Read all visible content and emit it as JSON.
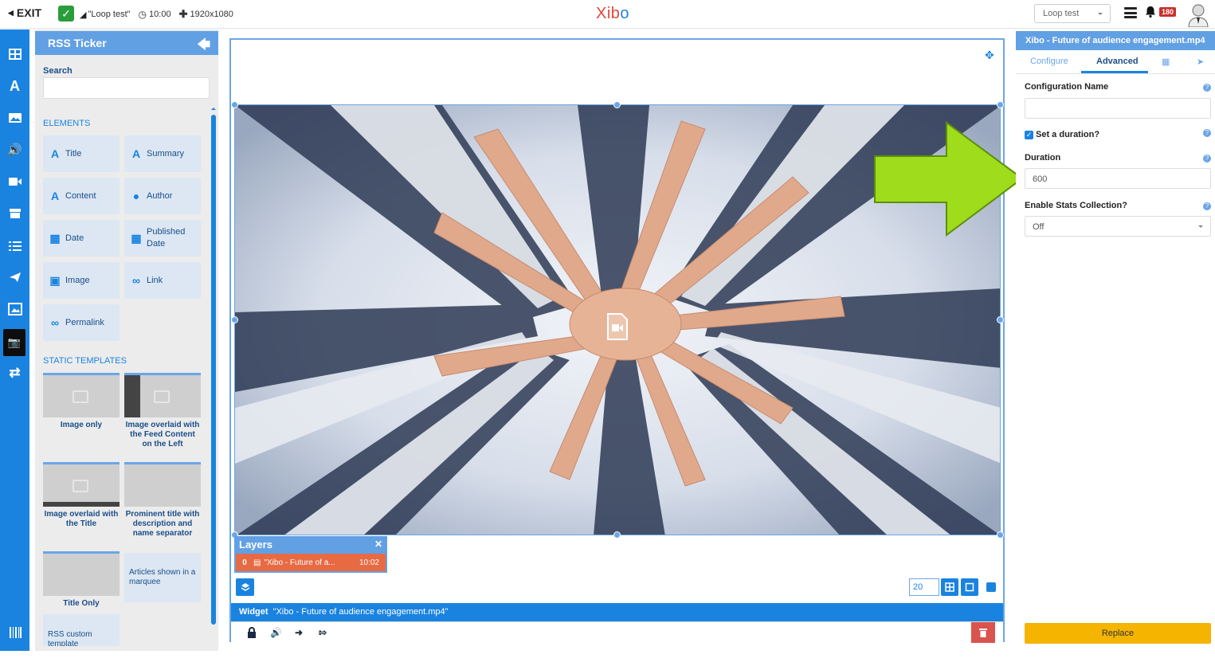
{
  "topbar": {
    "exit_label": "EXIT",
    "layout_name": "\"Loop test\"",
    "duration": "10:00",
    "resolution": "1920x1080",
    "logo_main": "Xib",
    "logo_accent": "o",
    "layout_select": "Loop test",
    "notification_count": "180"
  },
  "toolbox": {
    "title": "RSS Ticker",
    "search_label": "Search",
    "search_value": "",
    "elements_heading": "ELEMENTS",
    "elements": [
      {
        "label": "Title",
        "icon": "text-icon"
      },
      {
        "label": "Summary",
        "icon": "text-icon"
      },
      {
        "label": "Content",
        "icon": "text-icon"
      },
      {
        "label": "Author",
        "icon": "user-icon"
      },
      {
        "label": "Date",
        "icon": "calendar-icon"
      },
      {
        "label": "Published Date",
        "icon": "calendar-icon"
      },
      {
        "label": "Image",
        "icon": "image-icon"
      },
      {
        "label": "Link",
        "icon": "link-icon"
      },
      {
        "label": "Permalink",
        "icon": "link-icon"
      }
    ],
    "templates_heading": "STATIC TEMPLATES",
    "templates": [
      {
        "label": "Image only"
      },
      {
        "label": "Image overlaid with the Feed Content on the Left"
      },
      {
        "label": "Image overlaid with the Title"
      },
      {
        "label": "Prominent title with description and name separator"
      },
      {
        "label": "Title Only"
      },
      {
        "label": "Articles shown in a marquee"
      },
      {
        "label": "RSS custom template"
      }
    ]
  },
  "editor": {
    "layers_title": "Layers",
    "layer_row": {
      "index": "0",
      "name": "\"Xibo - Future of a...",
      "duration": "10:02"
    },
    "zoom_value": "20",
    "widget_label": "Widget",
    "widget_name": "\"Xibo - Future of audience engagement.mp4\""
  },
  "properties": {
    "title": "Xibo - Future of audience engagement.mp4",
    "tabs": [
      "Configure",
      "Advanced"
    ],
    "active_tab": "Advanced",
    "config_name_label": "Configuration Name",
    "config_name_value": "",
    "set_duration_label": "Set a duration?",
    "set_duration_checked": true,
    "duration_label": "Duration",
    "duration_value": "600",
    "stats_label": "Enable Stats Collection?",
    "stats_value": "Off",
    "replace_label": "Replace"
  },
  "colors": {
    "brand_blue": "#1a83e0",
    "panel_blue": "#62a0e4",
    "layer_orange": "#e86a43",
    "replace_yellow": "#f4b400",
    "annotation_green": "#9fdc1c"
  }
}
